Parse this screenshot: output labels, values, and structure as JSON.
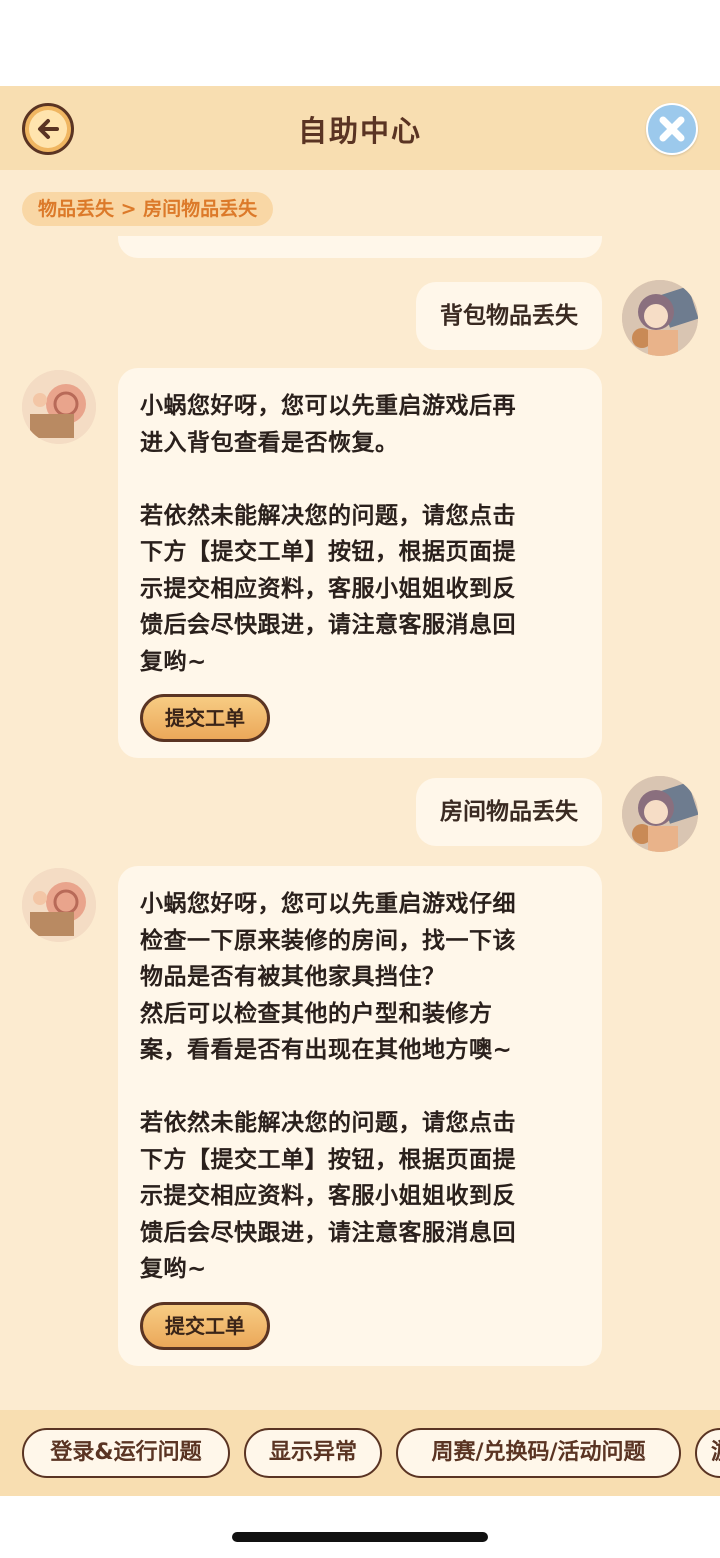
{
  "header": {
    "title": "自助中心",
    "back_icon": "arrow-left-icon",
    "close_icon": "close-x-icon"
  },
  "breadcrumb": "物品丢失 > 房间物品丢失",
  "messages": [
    {
      "from": "user",
      "text": "背包物品丢失"
    },
    {
      "from": "bot",
      "text": "小蜗您好呀，您可以先重启游戏后再\n进入背包查看是否恢复。\n\n若依然未能解决您的问题，请您点击\n下方【提交工单】按钮，根据页面提\n示提交相应资料，客服小姐姐收到反\n馈后会尽快跟进，请注意客服消息回\n复哟~",
      "button": "提交工单"
    },
    {
      "from": "user",
      "text": "房间物品丢失"
    },
    {
      "from": "bot",
      "text": "小蜗您好呀，您可以先重启游戏仔细\n检查一下原来装修的房间，找一下该\n物品是否有被其他家具挡住？\n然后可以检查其他的户型和装修方\n案，看看是否有出现在其他地方噢~\n\n若依然未能解决您的问题，请您点击\n下方【提交工单】按钮，根据页面提\n示提交相应资料，客服小姐姐收到反\n馈后会尽快跟进，请注意客服消息回\n复哟~",
      "button": "提交工单"
    }
  ],
  "quick_topics": [
    "登录&运行问题",
    "显示异常",
    "周赛/兑换码/活动问题",
    "游"
  ],
  "colors": {
    "header_bg": "#f8deb1",
    "chat_bg": "#fcebd0",
    "bubble_bg": "#fff7ea",
    "accent_brown": "#5a3423",
    "breadcrumb_text": "#dc7a2a",
    "button_orange": "#eba85a",
    "close_blue": "#9cc9ec"
  }
}
